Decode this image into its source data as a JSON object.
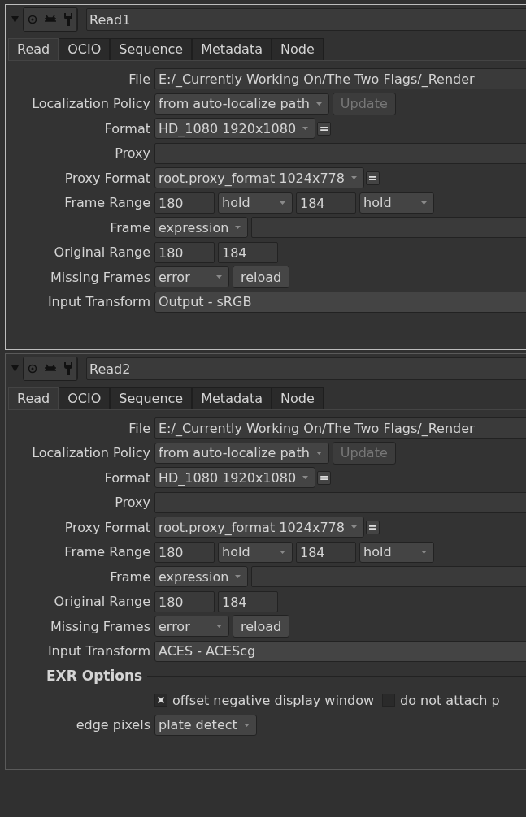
{
  "panels": [
    {
      "name": "Read1",
      "tabs": [
        {
          "label": "Read",
          "selected": true
        },
        {
          "label": "OCIO",
          "selected": false
        },
        {
          "label": "Sequence",
          "selected": false
        },
        {
          "label": "Metadata",
          "selected": false
        },
        {
          "label": "Node",
          "selected": false
        }
      ],
      "rows": [
        {
          "kind": "row",
          "label": "File",
          "controls": [
            {
              "kind": "wide_field",
              "value": "E:/_Currently Working On/The Two Flags/_Render"
            }
          ]
        },
        {
          "kind": "row",
          "label": "Localization Policy",
          "controls": [
            {
              "kind": "dropdown",
              "value": "from auto-localize path"
            },
            {
              "kind": "button",
              "label": "Update",
              "disabled": true
            }
          ]
        },
        {
          "kind": "row",
          "label": "Format",
          "controls": [
            {
              "kind": "dropdown",
              "value": "HD_1080 1920x1080"
            },
            {
              "kind": "equals",
              "label": "="
            }
          ]
        },
        {
          "kind": "row",
          "label": "Proxy",
          "controls": [
            {
              "kind": "wide_field"
            }
          ]
        },
        {
          "kind": "row",
          "label": "Proxy Format",
          "controls": [
            {
              "kind": "dropdown",
              "value": "root.proxy_format 1024x778"
            },
            {
              "kind": "equals",
              "label": "="
            }
          ]
        },
        {
          "kind": "row",
          "label": "Frame Range",
          "controls": [
            {
              "kind": "field",
              "value": "180"
            },
            {
              "kind": "dropdown",
              "value": "hold"
            },
            {
              "kind": "field",
              "value": "184"
            },
            {
              "kind": "dropdown",
              "value": "hold"
            }
          ]
        },
        {
          "kind": "row",
          "label": "Frame",
          "controls": [
            {
              "kind": "dropdown",
              "value": "expression"
            },
            {
              "kind": "wide_field"
            }
          ]
        },
        {
          "kind": "row",
          "label": "Original Range",
          "controls": [
            {
              "kind": "field",
              "value": "180"
            },
            {
              "kind": "field",
              "value": "184"
            }
          ]
        },
        {
          "kind": "row",
          "label": "Missing Frames",
          "controls": [
            {
              "kind": "dropdown",
              "value": "error"
            },
            {
              "kind": "button",
              "label": "reload",
              "disabled": false
            }
          ]
        },
        {
          "kind": "row",
          "label": "Input Transform",
          "controls": [
            {
              "kind": "wide_dropdown",
              "value": "Output - sRGB"
            }
          ]
        }
      ]
    },
    {
      "name": "Read2",
      "tabs": [
        {
          "label": "Read",
          "selected": true
        },
        {
          "label": "OCIO",
          "selected": false
        },
        {
          "label": "Sequence",
          "selected": false
        },
        {
          "label": "Metadata",
          "selected": false
        },
        {
          "label": "Node",
          "selected": false
        }
      ],
      "rows": [
        {
          "kind": "row",
          "label": "File",
          "controls": [
            {
              "kind": "wide_field",
              "value": "E:/_Currently Working On/The Two Flags/_Render"
            }
          ]
        },
        {
          "kind": "row",
          "label": "Localization Policy",
          "controls": [
            {
              "kind": "dropdown",
              "value": "from auto-localize path"
            },
            {
              "kind": "button",
              "label": "Update",
              "disabled": true
            }
          ]
        },
        {
          "kind": "row",
          "label": "Format",
          "controls": [
            {
              "kind": "dropdown",
              "value": "HD_1080 1920x1080"
            },
            {
              "kind": "equals",
              "label": "="
            }
          ]
        },
        {
          "kind": "row",
          "label": "Proxy",
          "controls": [
            {
              "kind": "wide_field"
            }
          ]
        },
        {
          "kind": "row",
          "label": "Proxy Format",
          "controls": [
            {
              "kind": "dropdown",
              "value": "root.proxy_format 1024x778"
            },
            {
              "kind": "equals",
              "label": "="
            }
          ]
        },
        {
          "kind": "row",
          "label": "Frame Range",
          "controls": [
            {
              "kind": "field",
              "value": "180"
            },
            {
              "kind": "dropdown",
              "value": "hold"
            },
            {
              "kind": "field",
              "value": "184"
            },
            {
              "kind": "dropdown",
              "value": "hold"
            }
          ]
        },
        {
          "kind": "row",
          "label": "Frame",
          "controls": [
            {
              "kind": "dropdown",
              "value": "expression"
            },
            {
              "kind": "wide_field"
            }
          ]
        },
        {
          "kind": "row",
          "label": "Original Range",
          "controls": [
            {
              "kind": "field",
              "value": "180"
            },
            {
              "kind": "field",
              "value": "184"
            }
          ]
        },
        {
          "kind": "row",
          "label": "Missing Frames",
          "controls": [
            {
              "kind": "dropdown",
              "value": "error"
            },
            {
              "kind": "button",
              "label": "reload",
              "disabled": false
            }
          ]
        },
        {
          "kind": "row",
          "label": "Input Transform",
          "controls": [
            {
              "kind": "wide_dropdown",
              "value": "ACES - ACEScg"
            }
          ]
        },
        {
          "kind": "section",
          "label": "EXR Options"
        },
        {
          "kind": "row",
          "controls": [
            {
              "kind": "checkbox",
              "label": "offset negative display window",
              "checked": true
            },
            {
              "kind": "checkbox",
              "label": "do not attach p",
              "checked": false
            }
          ]
        },
        {
          "kind": "row",
          "label": "edge pixels",
          "controls": [
            {
              "kind": "dropdown",
              "value": "plate detect"
            }
          ]
        }
      ]
    }
  ]
}
